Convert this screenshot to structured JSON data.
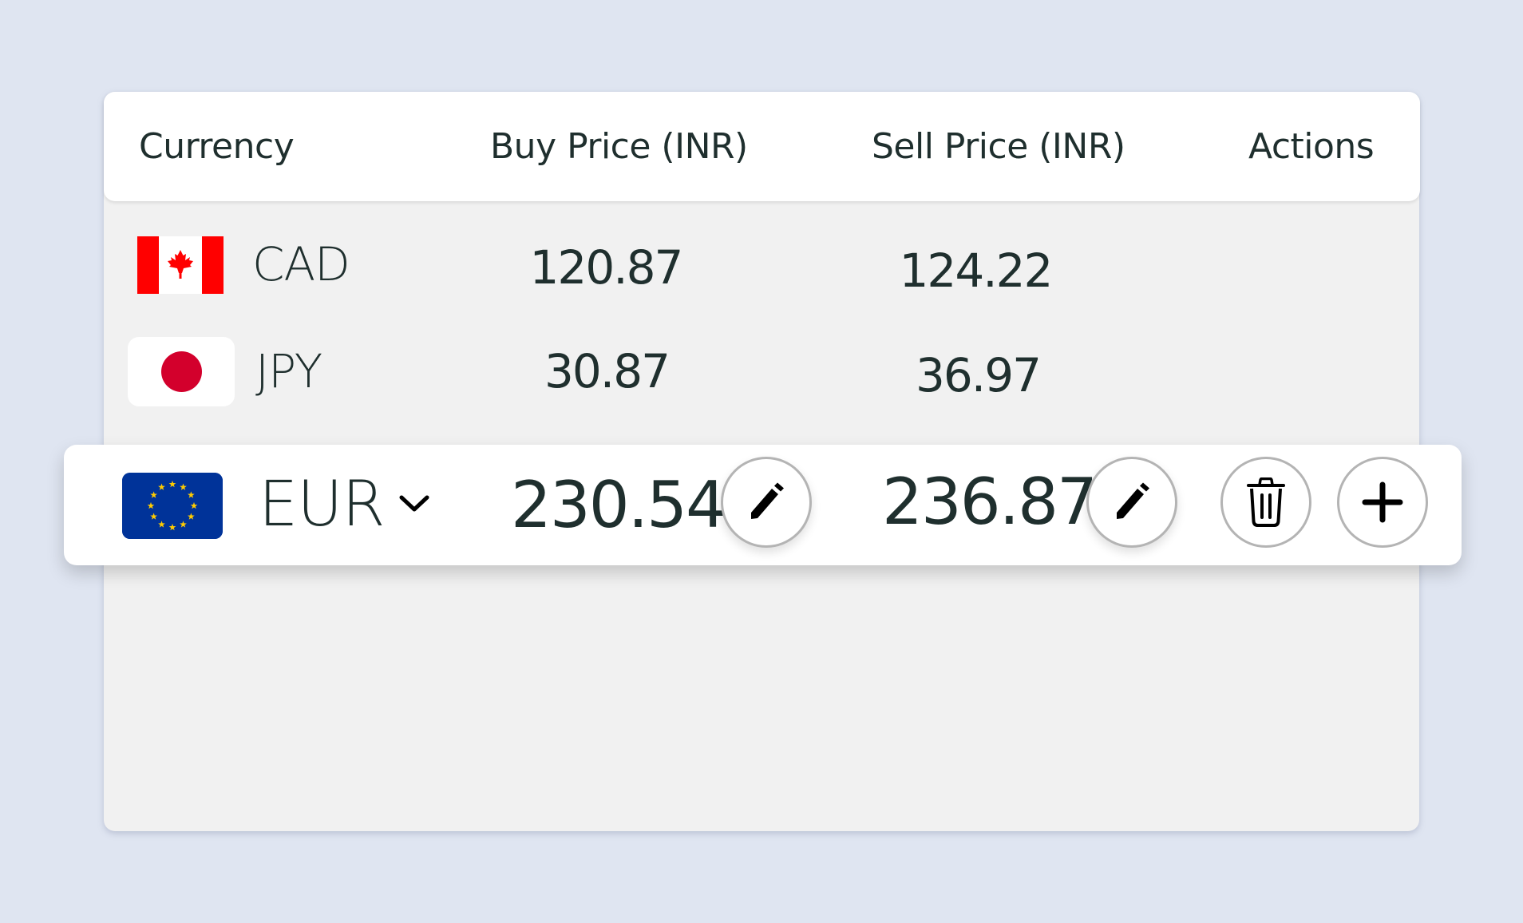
{
  "table": {
    "headers": {
      "currency": "Currency",
      "buy_price": "Buy Price (INR)",
      "sell_price": "Sell Price (INR)",
      "actions": "Actions"
    },
    "rows": [
      {
        "code": "CAD",
        "flag_icon": "canada-flag-icon",
        "buy": "120.87",
        "sell": "124.22"
      },
      {
        "code": "JPY",
        "flag_icon": "japan-flag-icon",
        "buy": "30.87",
        "sell": "36.97"
      }
    ],
    "editing_row": {
      "code": "EUR",
      "flag_icon": "eu-flag-icon",
      "dropdown_icon": "chevron-down-icon",
      "buy": "230.54",
      "sell": "236.87",
      "actions": {
        "edit_buy_icon": "pencil-icon",
        "edit_sell_icon": "pencil-icon",
        "delete_icon": "trash-icon",
        "add_icon": "plus-icon"
      }
    }
  },
  "colors": {
    "page_background": "#dfe5f1",
    "table_body": "#f1f1f1",
    "header_background": "#ffffff",
    "text": "#1f2f2e",
    "button_border": "#b4b4b4",
    "canada_red": "#ff0000",
    "japan_red": "#d3002c",
    "eu_blue": "#003399",
    "eu_star": "#ffcc00"
  }
}
